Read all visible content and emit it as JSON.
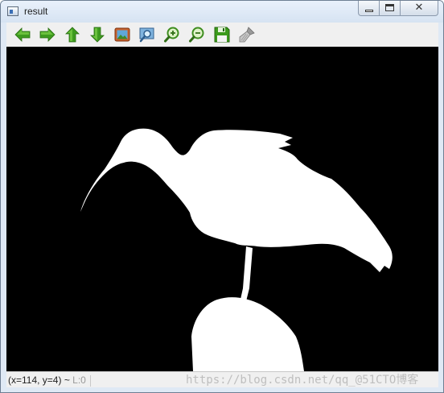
{
  "window": {
    "title": "result"
  },
  "title_controls": {
    "close_glyph": "✕"
  },
  "toolbar": {
    "buttons": [
      {
        "name": "pan-left-button",
        "icon": "arrow-left-icon"
      },
      {
        "name": "pan-right-button",
        "icon": "arrow-right-icon"
      },
      {
        "name": "pan-up-button",
        "icon": "arrow-up-icon"
      },
      {
        "name": "pan-down-button",
        "icon": "arrow-down-icon"
      },
      {
        "name": "zoom-original-button",
        "icon": "image-icon"
      },
      {
        "name": "zoom-fit-button",
        "icon": "zoom-region-icon"
      },
      {
        "name": "zoom-in-button",
        "icon": "zoom-in-icon"
      },
      {
        "name": "zoom-out-button",
        "icon": "zoom-out-icon"
      },
      {
        "name": "save-button",
        "icon": "floppy-disk-icon"
      },
      {
        "name": "properties-button",
        "icon": "brush-icon"
      }
    ],
    "colors": {
      "arrow_green": "#3e9b1f",
      "arrow_green_light": "#7fd24a"
    }
  },
  "canvas": {
    "background": "#000000",
    "foreground": "#ffffff",
    "image": "binary-mask-ibis-silhouette"
  },
  "status": {
    "coords": "(x=114, y=4) ~",
    "level": "L:0"
  },
  "watermark": {
    "text": "https://blog.csdn.net/qq_@51CTO博客"
  }
}
